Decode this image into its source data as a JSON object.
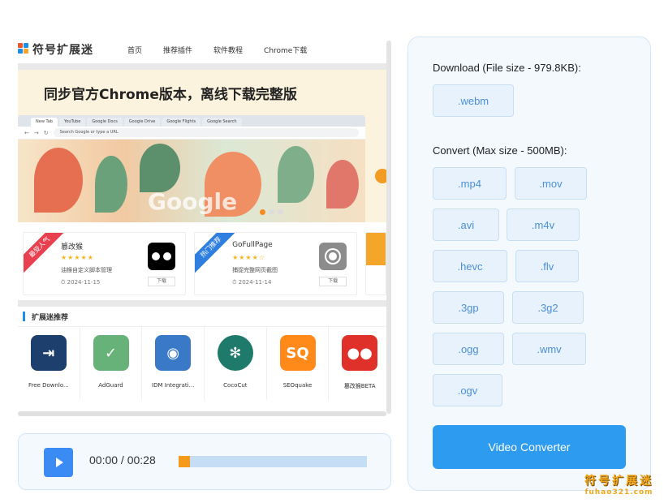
{
  "site": {
    "logo_text": "符号扩展迷",
    "nav": [
      "首页",
      "推荐插件",
      "软件教程",
      "Chrome下载"
    ],
    "banner_title": "同步官方Chrome版本，离线下载完整版",
    "mock_tabs": [
      "New Tab",
      "YouTube",
      "Google Docs",
      "Google Drive",
      "Google Flights",
      "Google Search"
    ],
    "mock_url_placeholder": "Search Google or type a URL",
    "google_word": "Google"
  },
  "cards": [
    {
      "ribbon": "最受人气",
      "ribbon_color": "#e8404f",
      "name": "篡改猴",
      "stars": "★★★★★",
      "desc": "油猴自定义脚本管理",
      "date": "⏱ 2024-11-15",
      "download": "下载",
      "icon": "tampermonkey-icon",
      "icon_color": "#000000"
    },
    {
      "ribbon": "热门推荐",
      "ribbon_color": "#2f7fe0",
      "name": "GoFullPage",
      "stars": "★★★★☆",
      "desc": "捕捉完整网页截图",
      "date": "⏱ 2024-11-14",
      "download": "下载",
      "icon": "camera-icon",
      "icon_color": "#777777"
    }
  ],
  "recommend": {
    "title": "扩展迷推荐",
    "apps": [
      {
        "label": "Free Downlo...",
        "icon": "free-download-manager-icon",
        "color": "#1c3f6e",
        "glyph": "⇥"
      },
      {
        "label": "AdGuard",
        "icon": "adguard-shield-icon",
        "color": "#67b279",
        "glyph": "✓"
      },
      {
        "label": "IDM Integrati...",
        "icon": "idm-globe-icon",
        "color": "#3a78c8",
        "glyph": "◉"
      },
      {
        "label": "CocoCut",
        "icon": "cococut-palm-icon",
        "color": "#1e7a6a",
        "glyph": "✻"
      },
      {
        "label": "SEOquake",
        "icon": "seoquake-icon",
        "color": "#ff8a1a",
        "glyph": "SQ"
      },
      {
        "label": "篡改猴BETA",
        "icon": "tampermonkey-beta-icon",
        "color": "#e0302a",
        "glyph": "●●"
      }
    ]
  },
  "player": {
    "time": "00:00 / 00:28",
    "progress": 0.06
  },
  "panel": {
    "download_label": "Download (File size - 979.8KB):",
    "download_formats": [
      ".webm"
    ],
    "convert_label": "Convert (Max size - 500MB):",
    "convert_formats": [
      ".mp4",
      ".mov",
      ".avi",
      ".m4v",
      ".hevc",
      ".flv",
      ".3gp",
      ".3g2",
      ".ogg",
      ".wmv",
      ".ogv"
    ],
    "convert_button": "Video Converter"
  },
  "watermark": {
    "cn": "符号扩展迷",
    "url": "fuhao321.com"
  }
}
